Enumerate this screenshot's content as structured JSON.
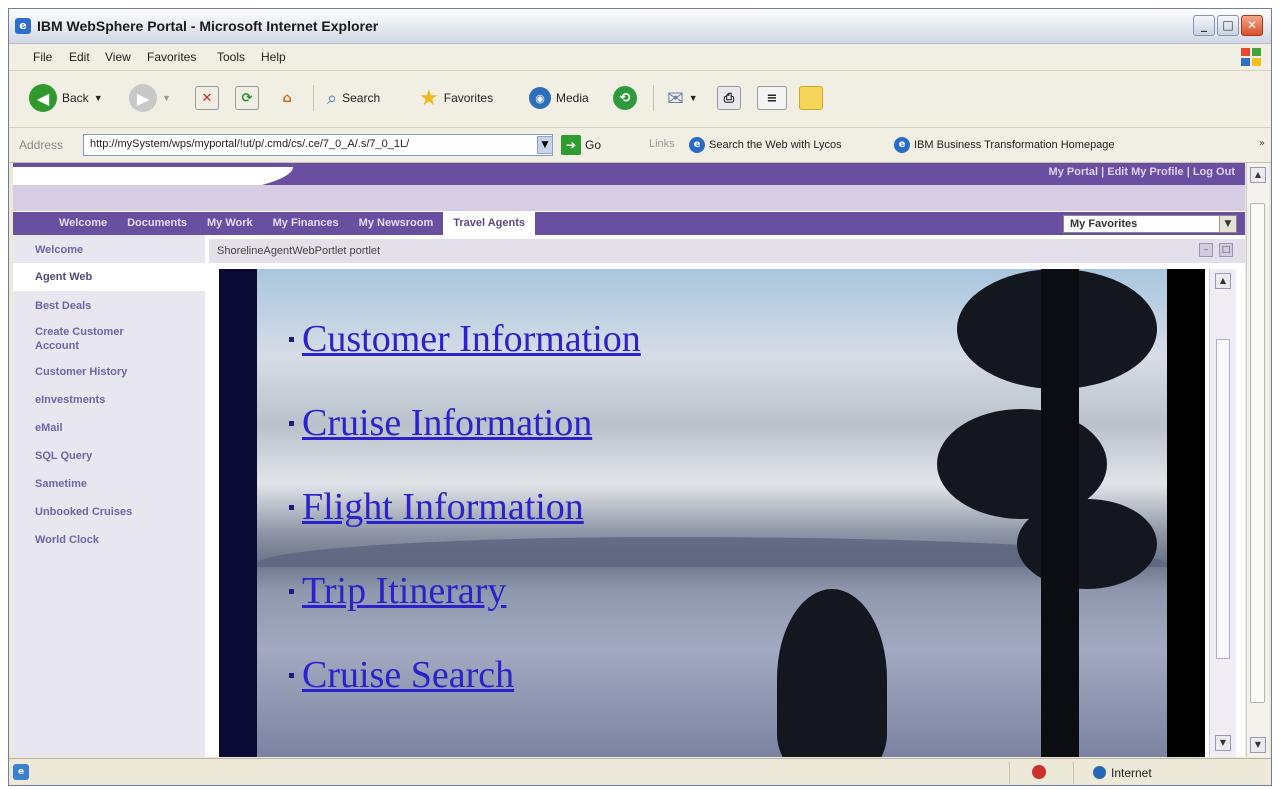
{
  "window": {
    "title": "IBM WebSphere Portal - Microsoft Internet Explorer",
    "controls": {
      "minimize": "_",
      "maximize": "□",
      "close": "✕"
    }
  },
  "menubar": {
    "items": [
      "File",
      "Edit",
      "View",
      "Favorites",
      "Tools",
      "Help"
    ]
  },
  "toolbar": {
    "back_label": "Back",
    "search_label": "Search",
    "favorites_label": "Favorites",
    "media_label": "Media"
  },
  "addressbar": {
    "label": "Address",
    "url": "http://mySystem/wps/myportal/!ut/p/.cmd/cs/.ce/7_0_A/.s/7_0_1L/",
    "go_label": "Go",
    "links_label": "Links",
    "links": [
      "Search the Web with Lycos",
      "IBM Business Transformation Homepage"
    ]
  },
  "portal": {
    "top_links": "My Portal  |  Edit My Profile  |  Log Out",
    "nav_tabs": [
      "Welcome",
      "Documents",
      "My Work",
      "My Finances",
      "My Newsroom",
      "Travel Agents"
    ],
    "active_tab": "Travel Agents",
    "favorites_select": "My Favorites",
    "sidebar": [
      "Welcome",
      "Agent Web",
      "Best Deals",
      "Create Customer Account",
      "Customer History",
      "eInvestments",
      "eMail",
      "SQL Query",
      "Sametime",
      "Unbooked Cruises",
      "World Clock"
    ],
    "active_sidebar": "Agent Web",
    "portlet_title": "ShorelineAgentWebPortlet portlet",
    "links": [
      "Customer Information",
      "Cruise Information",
      "Flight Information",
      "Trip Itinerary",
      "Cruise Search"
    ]
  },
  "statusbar": {
    "zone": "Internet"
  },
  "colors": {
    "portal_purple": "#6a4fa1",
    "link_blue": "#2b23c9",
    "sidebar_text": "#6b68a6"
  }
}
